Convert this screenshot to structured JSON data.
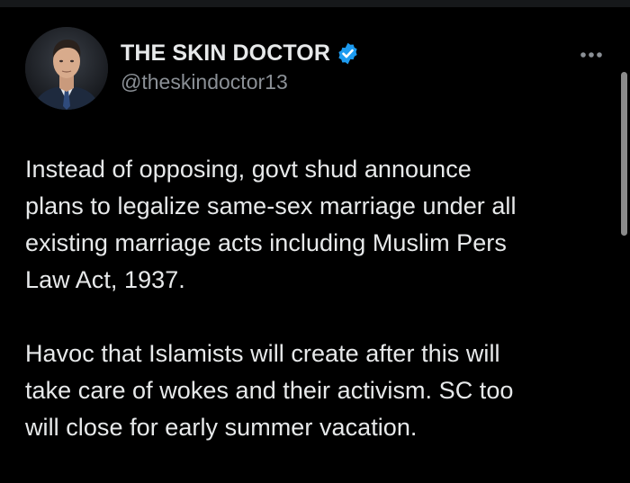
{
  "app": {
    "colors": {
      "background": "#000000",
      "text": "#e7e9ea",
      "secondary_text": "#8b9096",
      "verified_badge": "#1d9bf0"
    }
  },
  "post": {
    "author": {
      "display_name": "THE SKIN DOCTOR",
      "handle": "@theskindoctor13",
      "verified": true,
      "avatar_icon": "profile-photo-man-in-suit"
    },
    "menu_icon": "more-horizontal-icon",
    "paragraphs": [
      "Instead of opposing, govt shud announce\nplans to legalize same-sex marriage under all\nexisting marriage acts including Muslim Pers\nLaw Act, 1937.",
      "Havoc that Islamists will create after this will\ntake care of wokes and their activism. SC too\nwill close for early summer vacation."
    ]
  }
}
